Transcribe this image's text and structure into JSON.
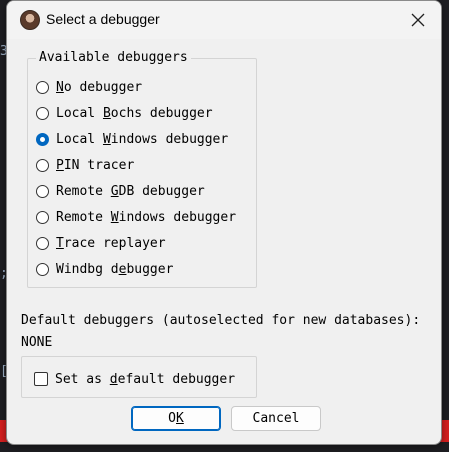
{
  "dialog": {
    "title": "Select a debugger",
    "close_icon": "close-icon",
    "app_icon": "app-avatar-icon"
  },
  "available_group": {
    "legend": "Available debuggers",
    "options": [
      {
        "label": "No debugger",
        "accel": "N",
        "checked": false
      },
      {
        "label": "Local Bochs debugger",
        "accel": "B",
        "checked": false
      },
      {
        "label": "Local Windows debugger",
        "accel": "W",
        "checked": true
      },
      {
        "label": "PIN tracer",
        "accel": "P",
        "checked": false
      },
      {
        "label": "Remote GDB debugger",
        "accel": "G",
        "checked": false
      },
      {
        "label": "Remote Windows debugger",
        "accel": "W",
        "checked": false
      },
      {
        "label": "Trace replayer",
        "accel": "T",
        "checked": false
      },
      {
        "label": "Windbg debugger",
        "accel": "e",
        "checked": false
      }
    ],
    "selected_index": 2
  },
  "defaults": {
    "label": "Default debuggers (autoselected for new databases):",
    "value": "NONE",
    "set_default_label": "Set as default debugger",
    "set_default_accel": "d",
    "set_default_checked": false
  },
  "buttons": {
    "ok_label": "OK",
    "ok_accel": "K",
    "cancel_label": "Cancel"
  },
  "colors": {
    "accent": "#0067c0",
    "background_bar": "#d61f1f"
  }
}
